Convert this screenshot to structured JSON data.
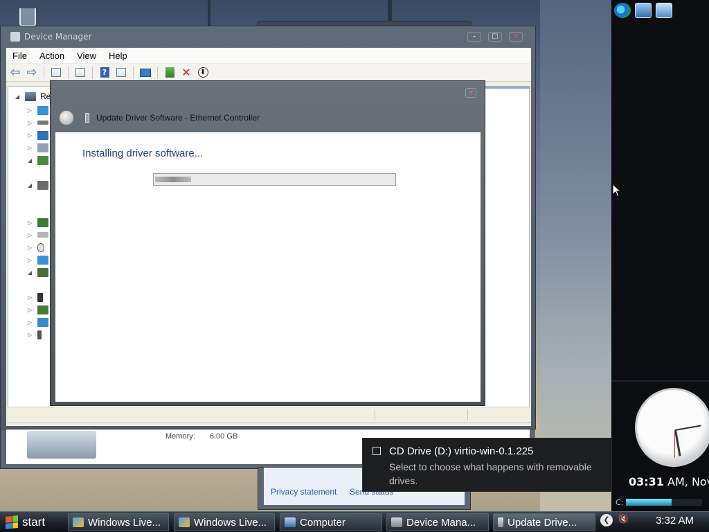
{
  "desktop": {
    "recycle_bin_icon": "recycle-bin-icon"
  },
  "device_manager": {
    "title": "Device Manager",
    "menu": [
      "File",
      "Action",
      "View",
      "Help"
    ],
    "tree_root_label": "Ret"
  },
  "update_driver": {
    "title": "Update Driver Software - Ethernet Controller",
    "heading": "Installing driver software...",
    "progress": 0.15
  },
  "system_window": {
    "memory_label": "Memory:",
    "memory_value": "6.00 GB"
  },
  "privacy_window": {
    "link1": "Privacy statement",
    "link2": "Send status"
  },
  "notification": {
    "title": "CD Drive (D:) virtio-win-0.1.225",
    "body": "Select to choose what happens with removable drives."
  },
  "sidebar": {
    "clock_time_bold": "03:31",
    "clock_time_rest": " AM, Nov",
    "cpu_label": "C:",
    "cpu_fill": 0.6
  },
  "taskbar": {
    "start_label": "start",
    "items": [
      {
        "label": "Windows Live..."
      },
      {
        "label": "Windows Live..."
      },
      {
        "label": "Computer"
      },
      {
        "label": "Device Mana..."
      },
      {
        "label": "Update Drive..."
      }
    ],
    "time": "3:32 AM"
  },
  "colors": {
    "accent_heading": "#1d3d8f",
    "link": "#2a5db0",
    "taskbar": "#1a1f26"
  }
}
